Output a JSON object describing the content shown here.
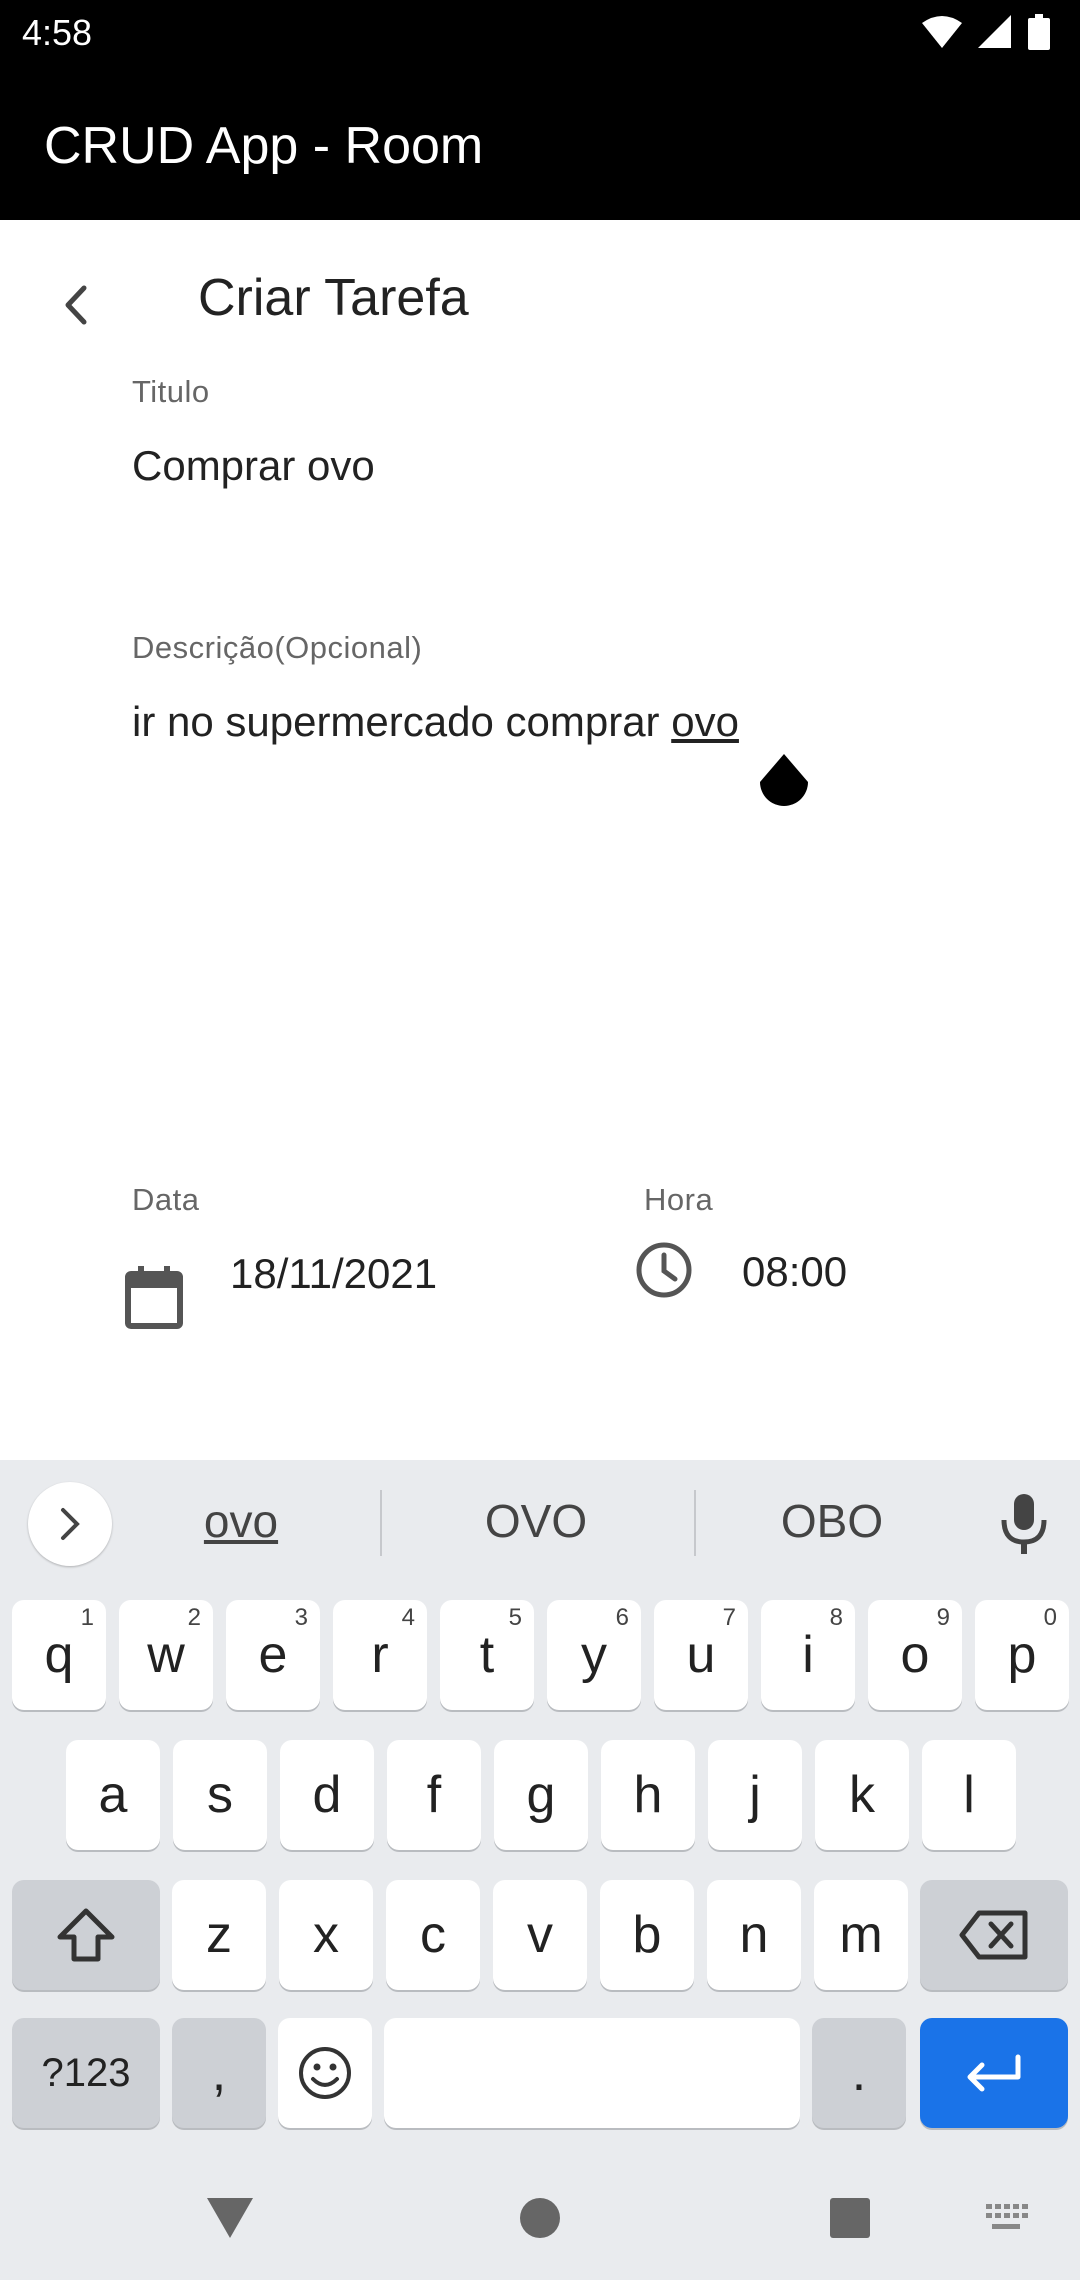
{
  "status_bar": {
    "time": "4:58"
  },
  "app_bar": {
    "title": "CRUD App - Room"
  },
  "header": {
    "title": "Criar Tarefa"
  },
  "form": {
    "title_label": "Titulo",
    "title_value": "Comprar ovo",
    "desc_label": "Descrição(Opcional)",
    "desc_value_prefix": "ir no supermercado comprar ",
    "desc_value_underlined": "ovo",
    "date_label": "Data",
    "date_value": "18/11/2021",
    "time_label": "Hora",
    "time_value": "08:00"
  },
  "keyboard": {
    "suggestions": [
      "ovo",
      "OVO",
      "OBO"
    ],
    "row1": [
      {
        "k": "q",
        "s": "1"
      },
      {
        "k": "w",
        "s": "2"
      },
      {
        "k": "e",
        "s": "3"
      },
      {
        "k": "r",
        "s": "4"
      },
      {
        "k": "t",
        "s": "5"
      },
      {
        "k": "y",
        "s": "6"
      },
      {
        "k": "u",
        "s": "7"
      },
      {
        "k": "i",
        "s": "8"
      },
      {
        "k": "o",
        "s": "9"
      },
      {
        "k": "p",
        "s": "0"
      }
    ],
    "row2": [
      "a",
      "s",
      "d",
      "f",
      "g",
      "h",
      "j",
      "k",
      "l"
    ],
    "row3": [
      "z",
      "x",
      "c",
      "v",
      "b",
      "n",
      "m"
    ],
    "symbols_label": "?123",
    "comma_label": ",",
    "period_label": ".",
    "colors": {
      "accent": "#1a73e8",
      "key": "#ffffff",
      "fn_key": "#cdd0d5",
      "background": "#e9ebee"
    }
  },
  "icons": {
    "back": "chevron-left-icon",
    "calendar": "calendar-icon",
    "clock": "clock-icon",
    "mic": "microphone-icon",
    "shift": "shift-icon",
    "backspace": "backspace-icon",
    "emoji": "emoji-icon",
    "enter": "enter-icon"
  }
}
